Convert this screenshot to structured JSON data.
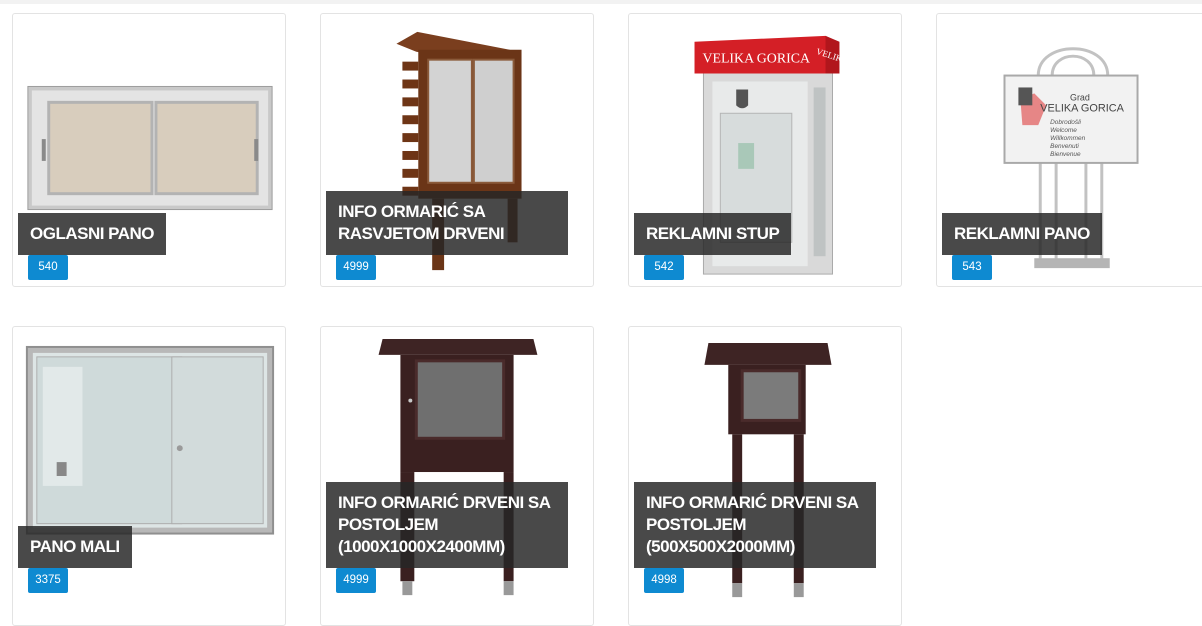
{
  "products": [
    {
      "title": "OGLASNI PANO",
      "badge": "540"
    },
    {
      "title": "INFO ORMARIĆ SA RASVJETOM DRVENI",
      "badge": "4999"
    },
    {
      "title": "REKLAMNI STUP",
      "badge": "542"
    },
    {
      "title": "REKLAMNI PANO",
      "badge": "543"
    },
    {
      "title": "PANO MALI",
      "badge": "3375"
    },
    {
      "title": "INFO ORMARIĆ DRVENI SA POSTOLJEM (1000X1000X2400MM)",
      "badge": "4999"
    },
    {
      "title": "INFO ORMARIĆ DRVENI SA POSTOLJEM (500X500X2000MM)",
      "badge": "4998"
    }
  ],
  "sign_texts": {
    "kiosk_roof": "VELIKA GORICA",
    "kiosk_roof_side": "VELIKA G",
    "board_city_prefix": "Grad",
    "board_city": "VELIKA GORICA",
    "greetings": [
      "Dobrodošli",
      "Welcome",
      "Willkommen",
      "Benvenuti",
      "Bienvenue"
    ]
  },
  "colors": {
    "badge": "#0e8ad1",
    "caption_bg": "#262626",
    "card_border": "#e3e3e3"
  }
}
